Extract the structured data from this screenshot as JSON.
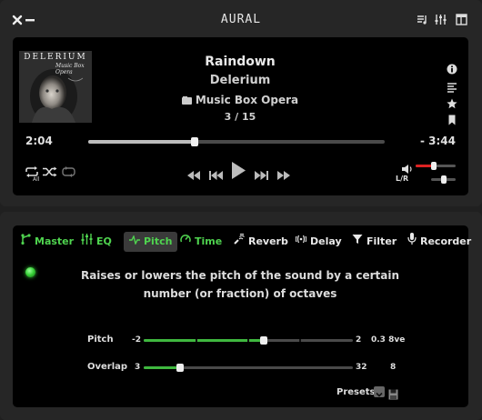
{
  "app": {
    "title": "AURAL"
  },
  "track": {
    "title": "Raindown",
    "artist": "Delerium",
    "album": "Music Box Opera",
    "position": "3 / 15",
    "art_text_top": "DELERIUM",
    "art_text_script": "Music Box Opera"
  },
  "playback": {
    "elapsed": "2:04",
    "remaining": "- 3:44",
    "progress": 0.36,
    "repeat_mode_label": "All",
    "volume": 0.45,
    "balance": 0.5,
    "balance_label": "L/R"
  },
  "effects": {
    "tabs": [
      {
        "label": "Master",
        "icon": "master-icon",
        "state": "enabled"
      },
      {
        "label": "EQ",
        "icon": "eq-icon",
        "state": "enabled"
      },
      {
        "label": "Pitch",
        "icon": "pitch-icon",
        "state": "enabled-selected"
      },
      {
        "label": "Time",
        "icon": "time-icon",
        "state": "enabled"
      },
      {
        "label": "Reverb",
        "icon": "reverb-icon",
        "state": "disabled"
      },
      {
        "label": "Delay",
        "icon": "delay-icon",
        "state": "disabled"
      },
      {
        "label": "Filter",
        "icon": "filter-icon",
        "state": "disabled"
      },
      {
        "label": "Recorder",
        "icon": "recorder-icon",
        "state": "disabled"
      }
    ],
    "pitch": {
      "description": "Raises or lowers the pitch of the sound by a certain number (or fraction) of octaves",
      "pitch_label": "Pitch",
      "pitch_min": "-2",
      "pitch_max": "2",
      "pitch_value_text": "0.3 8ve",
      "pitch_value": 0.3,
      "pitch_range": [
        -2,
        2
      ],
      "overlap_label": "Overlap",
      "overlap_min": "3",
      "overlap_max": "32",
      "overlap_value_text": "8",
      "overlap_value": 8,
      "overlap_range": [
        3,
        32
      ]
    },
    "presets_label": "Presets"
  },
  "colors": {
    "accent_green": "#4fd34f",
    "volume_red": "#dd2222",
    "panel_bg": "#000000",
    "window_bg": "#262626"
  }
}
